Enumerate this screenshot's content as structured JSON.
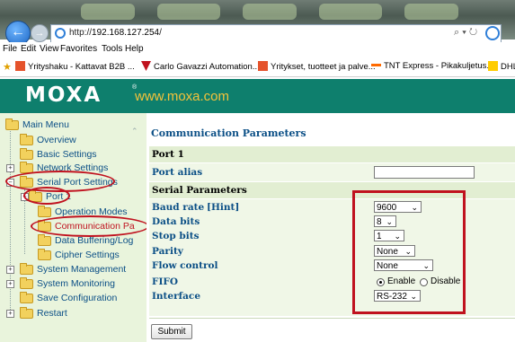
{
  "browser": {
    "url_prefix": "http://",
    "url_host": "192.168.127.254",
    "url_suffix": "/",
    "address_tools": "⌕ ▾ ↻",
    "menu": [
      "File",
      "Edit",
      "View",
      "Favorites",
      "Tools",
      "Help"
    ],
    "favorites": [
      {
        "label": "Yrityshaku - Kattavat B2B ...",
        "icon_color": "#e5532c"
      },
      {
        "label": "Carlo Gavazzi Automation...",
        "icon_color": "#c0121f"
      },
      {
        "label": "Yritykset, tuotteet ja palve...",
        "icon_color": "#e5532c"
      },
      {
        "label": "TNT Express - Pikakuljetus...",
        "icon_color": "#ff6a00"
      },
      {
        "label": "DHL",
        "icon_color": "#ffcc00"
      }
    ]
  },
  "banner": {
    "logo": "MOXA",
    "reg": "®",
    "site": "www.moxa.com",
    "bg_color": "#0e7f6d",
    "site_color": "#f4c33a"
  },
  "sidebar": {
    "items": [
      {
        "label": "Main Menu"
      },
      {
        "label": "Overview"
      },
      {
        "label": "Basic Settings"
      },
      {
        "label": "Network Settings"
      },
      {
        "label": "Serial Port Settings"
      },
      {
        "label": "Port 1"
      },
      {
        "label": "Operation Modes"
      },
      {
        "label": "Communication Pa"
      },
      {
        "label": "Data Buffering/Log"
      },
      {
        "label": "Cipher Settings"
      },
      {
        "label": "System Management"
      },
      {
        "label": "System Monitoring"
      },
      {
        "label": "Save Configuration"
      },
      {
        "label": "Restart"
      }
    ]
  },
  "main": {
    "title": "Communication Parameters",
    "port_section": "Port 1",
    "port_alias_label": "Port alias",
    "port_alias_value": "",
    "serial_section": "Serial Parameters",
    "baud_label": "Baud rate",
    "hint": "[Hint]",
    "baud_value": "9600",
    "data_bits_label": "Data bits",
    "data_bits_value": "8",
    "stop_bits_label": "Stop bits",
    "stop_bits_value": "1",
    "parity_label": "Parity",
    "parity_value": "None",
    "flow_label": "Flow control",
    "flow_value": "None",
    "fifo_label": "FIFO",
    "fifo_enable": "Enable",
    "fifo_disable": "Disable",
    "fifo_selected": "Enable",
    "interface_label": "Interface",
    "interface_value": "RS-232",
    "submit_label": "Submit"
  },
  "colors": {
    "annotation_red": "#c0121f",
    "sidebar_bg": "#e9f4dc",
    "link_blue": "#0b4f86"
  }
}
